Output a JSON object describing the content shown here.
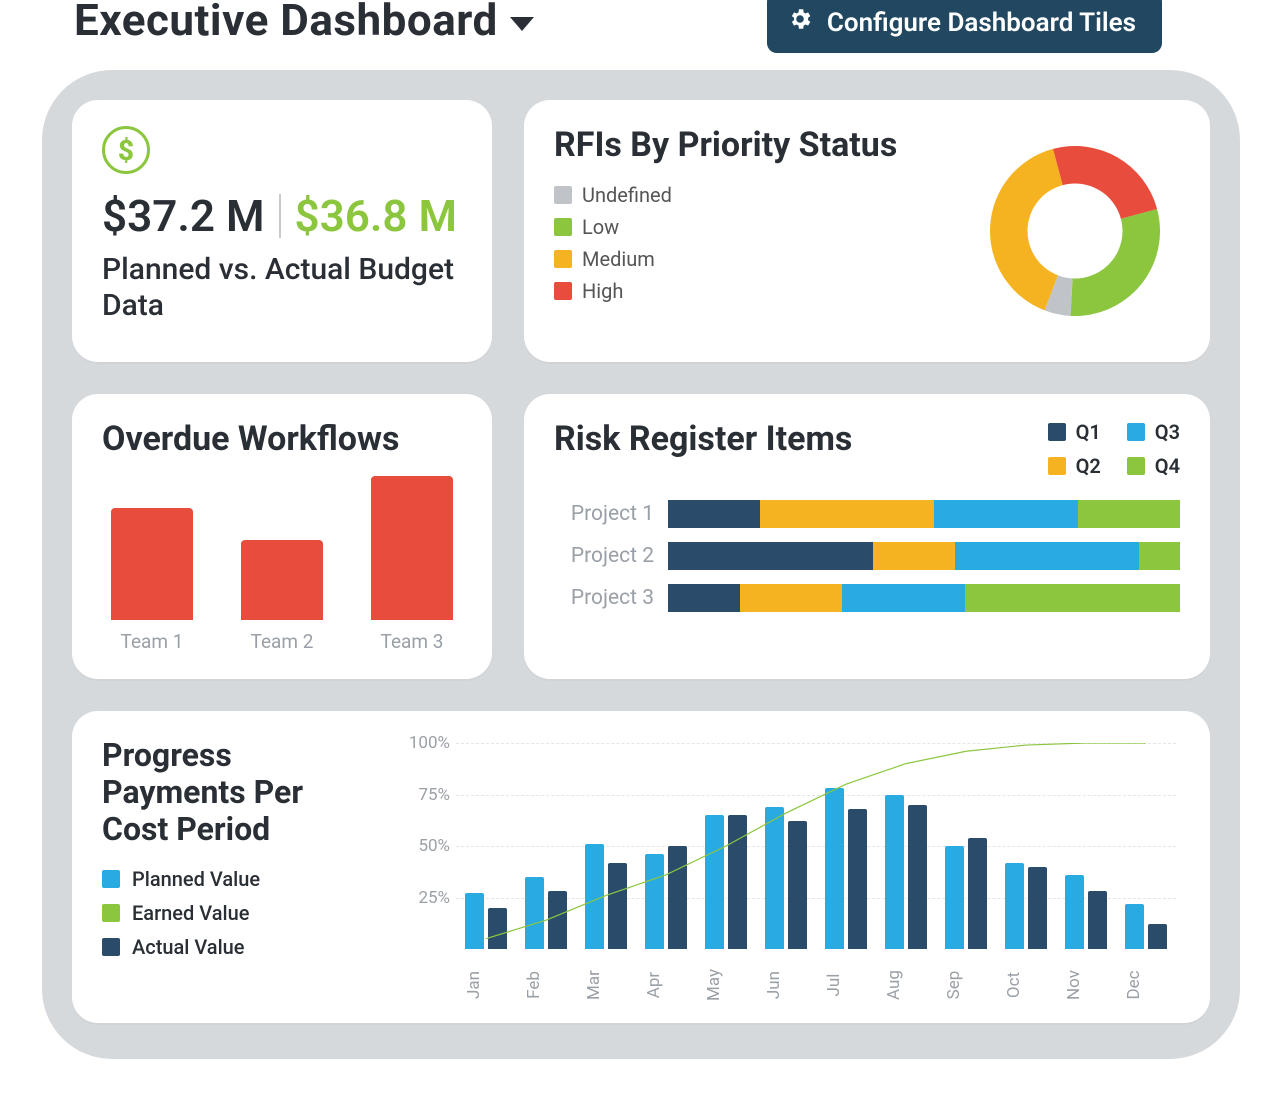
{
  "header": {
    "title": "Executive Dashboard",
    "configure_label": "Configure Dashboard Tiles"
  },
  "tiles": {
    "budget": {
      "planned": "$37.2 M",
      "actual": "$36.8 M",
      "subtitle": "Planned vs. Actual Budget Data"
    },
    "rfi": {
      "title": "RFIs By Priority Status",
      "legend": [
        "Undefined",
        "Low",
        "Medium",
        "High"
      ]
    },
    "overdue": {
      "title": "Overdue Workflows",
      "labels": [
        "Team 1",
        "Team 2",
        "Team 3"
      ]
    },
    "risk": {
      "title": "Risk Register Items",
      "legend": [
        "Q1",
        "Q2",
        "Q3",
        "Q4"
      ],
      "rows": [
        "Project 1",
        "Project 2",
        "Project 3"
      ]
    },
    "progress": {
      "title": "Progress Payments Per Cost Period",
      "legend": [
        "Planned Value",
        "Earned Value",
        "Actual Value"
      ],
      "yticks": [
        "100%",
        "75%",
        "50%",
        "25%"
      ],
      "months": [
        "Jan",
        "Feb",
        "Mar",
        "Apr",
        "May",
        "Jun",
        "Jul",
        "Aug",
        "Sep",
        "Oct",
        "Nov",
        "Dec"
      ]
    }
  },
  "colors": {
    "green": "#8cc63f",
    "yellow": "#f6b321",
    "red": "#e74c3c",
    "cyan": "#29abe2",
    "navy": "#2a4b6a",
    "grey": "#c0c4c9"
  },
  "chart_data": [
    {
      "id": "rfi_donut",
      "type": "pie",
      "title": "RFIs By Priority Status",
      "series": [
        {
          "name": "Undefined",
          "value": 5,
          "color": "#c0c4c9"
        },
        {
          "name": "Low",
          "value": 30,
          "color": "#8cc63f"
        },
        {
          "name": "Medium",
          "value": 40,
          "color": "#f6b321"
        },
        {
          "name": "High",
          "value": 25,
          "color": "#e74c3c"
        }
      ]
    },
    {
      "id": "overdue_bar",
      "type": "bar",
      "title": "Overdue Workflows",
      "xlabel": "",
      "ylabel": "",
      "ylim": [
        0,
        10
      ],
      "categories": [
        "Team 1",
        "Team 2",
        "Team 3"
      ],
      "values": [
        7,
        5,
        9
      ]
    },
    {
      "id": "risk_stacked",
      "type": "bar",
      "stacked": true,
      "orientation": "horizontal",
      "title": "Risk Register Items",
      "xlim": [
        0,
        100
      ],
      "categories": [
        "Project 1",
        "Project 2",
        "Project 3"
      ],
      "series": [
        {
          "name": "Q1",
          "color": "#2a4b6a",
          "values": [
            18,
            40,
            14
          ]
        },
        {
          "name": "Q2",
          "color": "#f6b321",
          "values": [
            34,
            16,
            20
          ]
        },
        {
          "name": "Q3",
          "color": "#29abe2",
          "values": [
            28,
            36,
            24
          ]
        },
        {
          "name": "Q4",
          "color": "#8cc63f",
          "values": [
            20,
            8,
            42
          ]
        }
      ]
    },
    {
      "id": "progress_combo",
      "type": "bar",
      "title": "Progress Payments Per Cost Period",
      "xlabel": "",
      "ylabel": "",
      "ylim": [
        0,
        100
      ],
      "yticks": [
        25,
        50,
        75,
        100
      ],
      "categories": [
        "Jan",
        "Feb",
        "Mar",
        "Apr",
        "May",
        "Jun",
        "Jul",
        "Aug",
        "Sep",
        "Oct",
        "Nov",
        "Dec"
      ],
      "series": [
        {
          "name": "Planned Value",
          "type": "bar",
          "color": "#29abe2",
          "values": [
            27,
            35,
            51,
            46,
            65,
            69,
            78,
            75,
            50,
            42,
            36,
            22
          ]
        },
        {
          "name": "Actual Value",
          "type": "bar",
          "color": "#2a4b6a",
          "values": [
            20,
            28,
            42,
            50,
            65,
            62,
            68,
            70,
            54,
            40,
            28,
            12
          ]
        },
        {
          "name": "Earned Value",
          "type": "line",
          "color": "#8cc63f",
          "values": [
            5,
            14,
            26,
            36,
            50,
            66,
            80,
            90,
            96,
            99,
            100,
            100
          ]
        }
      ]
    }
  ]
}
